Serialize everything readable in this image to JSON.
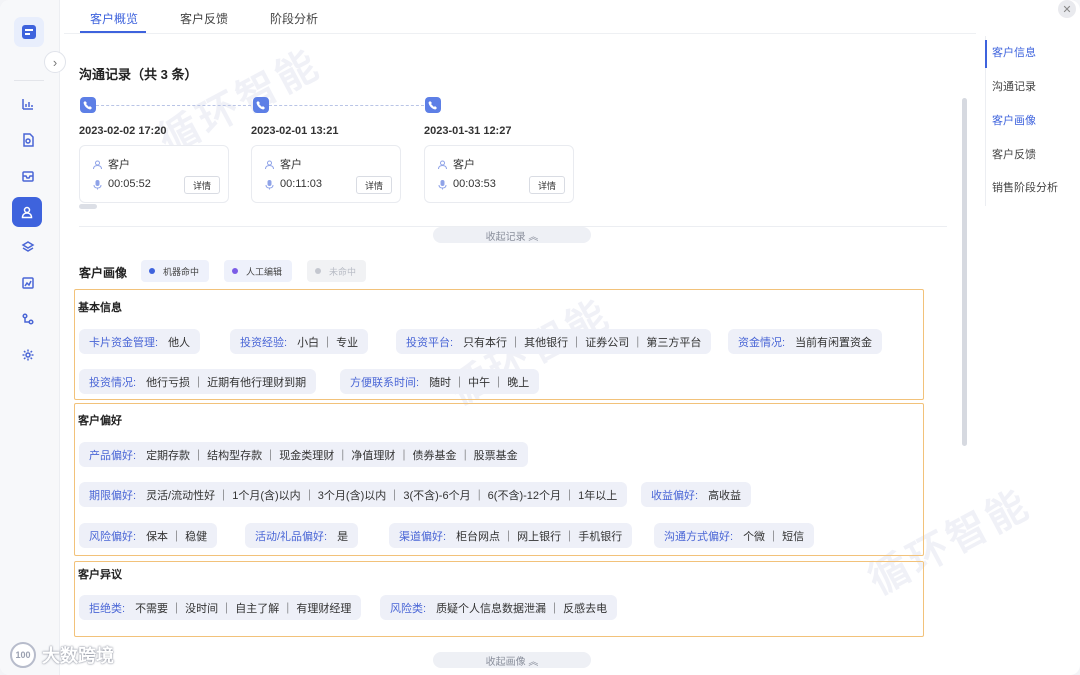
{
  "tabs": [
    {
      "label": "客户概览",
      "active": true
    },
    {
      "label": "客户反馈",
      "active": false
    },
    {
      "label": "阶段分析",
      "active": false
    }
  ],
  "sidebar": {
    "icons": [
      "chart-bar-icon",
      "document-search-icon",
      "inbox-icon",
      "user-icon",
      "layers-icon",
      "report-chart-icon",
      "workflow-icon",
      "settings-icon"
    ],
    "active_index": 3
  },
  "communication": {
    "title": "沟通记录（共 3 条）",
    "records": [
      {
        "datetime": "2023-02-02 17:20",
        "role": "客户",
        "duration": "00:05:52",
        "detail_label": "详情"
      },
      {
        "datetime": "2023-02-01 13:21",
        "role": "客户",
        "duration": "00:11:03",
        "detail_label": "详情"
      },
      {
        "datetime": "2023-01-31 12:27",
        "role": "客户",
        "duration": "00:03:53",
        "detail_label": "详情"
      }
    ],
    "collapse_label": "收起记录 ︽"
  },
  "portrait": {
    "title": "客户画像",
    "legend": [
      {
        "label": "机器命中",
        "color": "#3e63dd",
        "disabled": false
      },
      {
        "label": "人工编辑",
        "color": "#7b5ce6",
        "disabled": false
      },
      {
        "label": "未命中",
        "color": "#c4c7cf",
        "disabled": true
      }
    ],
    "groups": {
      "basic": {
        "title": "基本信息",
        "tags": [
          {
            "key": "卡片资金管理:",
            "value": "他人"
          },
          {
            "key": "投资经验:",
            "value": "小白 ｜ 专业"
          },
          {
            "key": "投资平台:",
            "value": "只有本行 ｜ 其他银行 ｜ 证券公司 ｜ 第三方平台"
          },
          {
            "key": "资金情况:",
            "value": "当前有闲置资金"
          },
          {
            "key": "投资情况:",
            "value": "他行亏损 ｜ 近期有他行理财到期"
          },
          {
            "key": "方便联系时间:",
            "value": "随时 ｜ 中午 ｜ 晚上"
          }
        ]
      },
      "preference": {
        "title": "客户偏好",
        "tags": [
          {
            "key": "产品偏好:",
            "value": "定期存款 ｜ 结构型存款 ｜ 现金类理财 ｜ 净值理财 ｜ 债券基金 ｜ 股票基金"
          },
          {
            "key": "期限偏好:",
            "value": "灵活/流动性好 ｜ 1个月(含)以内 ｜ 3个月(含)以内 ｜ 3(不含)-6个月 ｜ 6(不含)-12个月 ｜ 1年以上"
          },
          {
            "key": "收益偏好:",
            "value": "高收益"
          },
          {
            "key": "风险偏好:",
            "value": "保本 ｜ 稳健"
          },
          {
            "key": "活动/礼品偏好:",
            "value": "是"
          },
          {
            "key": "渠道偏好:",
            "value": "柜台网点 ｜ 网上银行 ｜ 手机银行"
          },
          {
            "key": "沟通方式偏好:",
            "value": "个微 ｜ 短信"
          }
        ]
      },
      "objection": {
        "title": "客户异议",
        "tags": [
          {
            "key": "拒绝类:",
            "value": "不需要 ｜ 没时间 ｜ 自主了解 ｜ 有理财经理"
          },
          {
            "key": "风险类:",
            "value": "质疑个人信息数据泄漏 ｜ 反感去电"
          }
        ]
      }
    },
    "collapse_label": "收起画像 ︽"
  },
  "anchor_nav": {
    "items": [
      "客户信息",
      "沟通记录",
      "客户画像",
      "客户反馈",
      "销售阶段分析"
    ],
    "active_index": 0,
    "highlight_index": 2
  },
  "watermark": {
    "text": "循环智能"
  },
  "brand": {
    "text": "大数跨境",
    "badge": "100"
  }
}
